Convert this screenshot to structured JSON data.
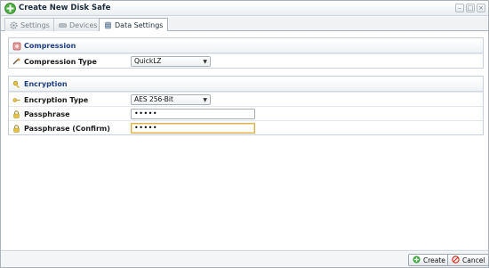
{
  "window": {
    "title": "Create New Disk Safe",
    "controls": {
      "minimize": "–",
      "maximize": "□",
      "close": "×"
    }
  },
  "tabs": [
    {
      "label": "Settings",
      "icon": "gear-icon"
    },
    {
      "label": "Devices",
      "icon": "devices-icon"
    },
    {
      "label": "Data Settings",
      "icon": "database-icon",
      "active": true
    }
  ],
  "compression": {
    "header": "Compression",
    "type_label": "Compression Type",
    "type_value": "QuickLZ"
  },
  "encryption": {
    "header": "Encryption",
    "type_label": "Encryption Type",
    "type_value": "AES 256-Bit",
    "passphrase_label": "Passphrase",
    "passphrase_value": "•••••",
    "confirm_label": "Passphrase (Confirm)",
    "confirm_value": "•••••"
  },
  "footer": {
    "create_label": "Create",
    "cancel_label": "Cancel"
  },
  "colors": {
    "header_text": "#1e3f80",
    "create_icon": "#3aa53a",
    "cancel_icon": "#d43a2a"
  }
}
